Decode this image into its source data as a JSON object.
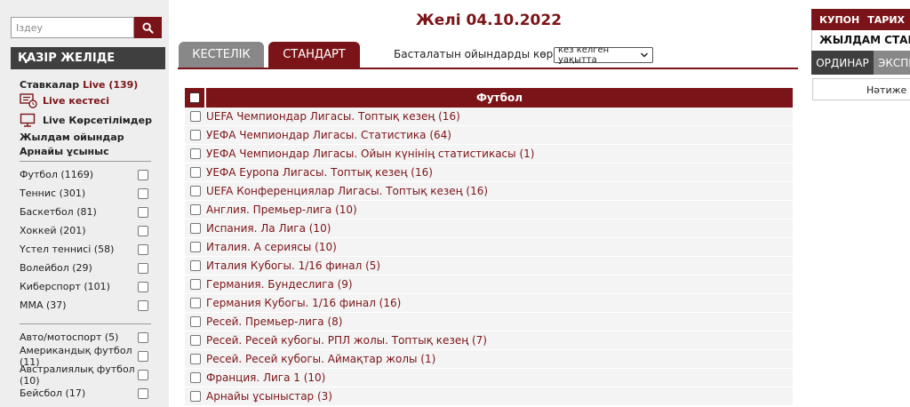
{
  "search": {
    "placeholder": "Іздеу"
  },
  "sidebar": {
    "heading": "ҚАЗІР ЖЕЛІДЕ",
    "live_bets_label": "Ставкалар",
    "live_bets_suffix": "Live (139)",
    "live_schedule_prefix": "Live",
    "live_schedule_label": "кестесі",
    "live_broadcast_prefix": "Live",
    "live_broadcast_label": "Көрсетілімдер",
    "quick_games": "Жылдам ойындар",
    "special_offer": "Арнайы ұсыныс",
    "sports_group1": [
      "Футбол (1169)",
      "Теннис (301)",
      "Баскетбол (81)",
      "Хоккей (201)",
      "Үстел теннисі (58)",
      "Волейбол (29)",
      "Киберспорт (101)",
      "ММА (37)"
    ],
    "sports_group2": [
      "Авто/мотоспорт (5)",
      "Американдық футбол (11)",
      "Австралиялық футбол (10)",
      "Бейсбол (17)"
    ]
  },
  "main": {
    "title": "Желі 04.10.2022",
    "tabs": {
      "table": "КЕСТЕЛІК",
      "standard": "СТАНДАРТ"
    },
    "show_label": "Басталатын ойындарды көрсету",
    "show_select_value": "кез келген уақытта",
    "grid_title": "Футбол",
    "leagues": [
      "UEFA Чемпиондар Лигасы. Топтық кезең (16)",
      "УЕФА Чемпиондар Лигасы. Статистика (64)",
      "УЕФА Чемпиондар Лигасы. Ойын күнінің статистикасы (1)",
      "УЕФА Еуропа Лигасы. Топтық кезең (16)",
      "UEFA Конференциялар Лигасы. Топтық кезең (16)",
      "Англия. Премьер-лига (10)",
      "Испания. Ла Лига (10)",
      "Италия. А сериясы (10)",
      "Италия Кубогы. 1/16 финал (5)",
      "Германия. Бундеслига (9)",
      "Германия Кубогы. 1/16 финал (16)",
      "Ресей. Премьер-лига (8)",
      "Ресей. Ресей кубогы. РПЛ жолы. Топтық кезең (7)",
      "Ресей. Ресей кубогы. Аймақтар жолы (1)",
      "Франция. Лига 1 (10)",
      "Арнайы ұсыныстар (3)"
    ]
  },
  "right": {
    "coupon": "КУПОН",
    "history": "ТАРИХ",
    "quick_bet": "ЖЫЛДАМ СТАВ",
    "ordinar": "ОРДИНАР",
    "express": "ЭКСПР",
    "result": "Нәтиже т"
  },
  "colors": {
    "accent": "#7b1418",
    "dark": "#3f3f3f",
    "gray_tab": "#888888"
  },
  "icons": [
    "search-icon",
    "live-schedule-icon",
    "live-broadcast-icon",
    "chevron-down-icon"
  ]
}
